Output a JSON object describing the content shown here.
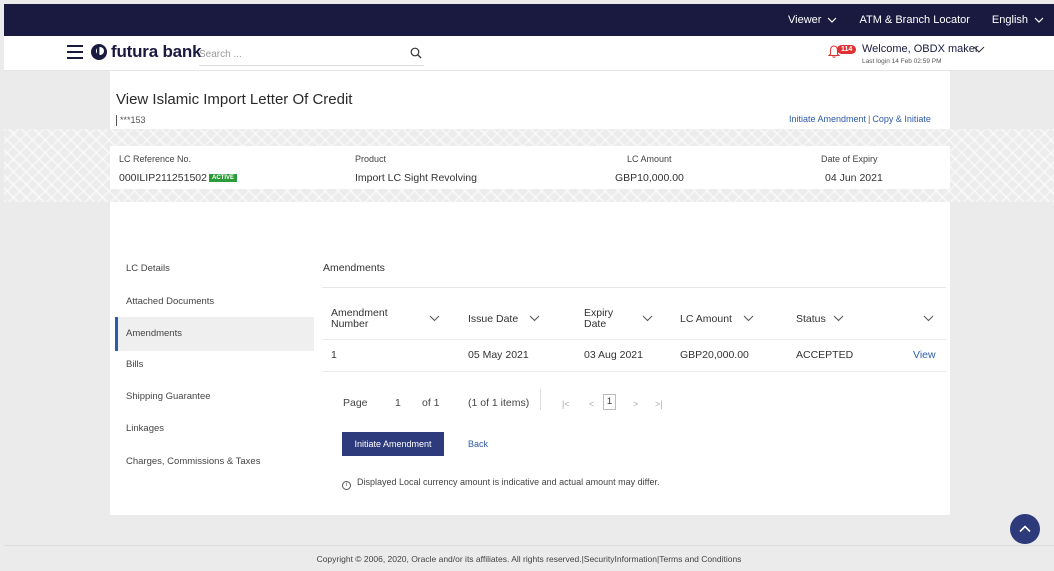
{
  "topbar": {
    "viewer": "Viewer",
    "atm_locator": "ATM & Branch Locator",
    "language": "English"
  },
  "header": {
    "logo_text": "futura bank",
    "search_placeholder": "Search ...",
    "notification_count": "114",
    "welcome": "Welcome, OBDX maker",
    "last_login": "Last login 14 Feb 02:59 PM"
  },
  "page": {
    "title": "View Islamic Import Letter Of Credit",
    "account": "***153",
    "link_initiate_amendment": "Initiate Amendment",
    "link_copy_initiate": "Copy & Initiate"
  },
  "summary": {
    "lc_ref_label": "LC Reference No.",
    "lc_ref_value": "000ILIP211251502",
    "status_badge": "ACTIVE",
    "product_label": "Product",
    "product_value": "Import LC Sight Revolving",
    "amount_label": "LC Amount",
    "amount_value": "GBP10,000.00",
    "expiry_label": "Date of Expiry",
    "expiry_value": "04 Jun 2021"
  },
  "nav": {
    "items": [
      "LC Details",
      "Attached Documents",
      "Amendments",
      "Bills",
      "Shipping Guarantee",
      "Linkages",
      "Charges, Commissions & Taxes"
    ],
    "selected": "Amendments"
  },
  "amendments": {
    "title": "Amendments",
    "columns": {
      "number_l1": "Amendment",
      "number_l2": "Number",
      "issue_date": "Issue Date",
      "expiry_l1": "Expiry",
      "expiry_l2": "Date",
      "lc_amount": "LC Amount",
      "status": "Status"
    },
    "rows": [
      {
        "number": "1",
        "issue_date": "05 May 2021",
        "expiry_date": "03 Aug 2021",
        "lc_amount": "GBP20,000.00",
        "status": "ACCEPTED",
        "action": "View"
      }
    ]
  },
  "pagination": {
    "page_label": "Page",
    "page_value": "1",
    "of_label": "of 1",
    "items_label": "(1 of 1 items)",
    "current": "1"
  },
  "actions": {
    "initiate_amendment": "Initiate Amendment",
    "back": "Back"
  },
  "note": "Displayed Local currency amount is indicative and actual amount may differ.",
  "footer": "Copyright © 2006, 2020, Oracle and/or its affiliates. All rights reserved.|SecurityInformation|Terms and Conditions",
  "colors": {
    "navy": "#1a1a40",
    "primary_button": "#2d3a7c",
    "link": "#2d5ba8",
    "active_badge": "#2c9b3a",
    "notification": "#e03232"
  }
}
